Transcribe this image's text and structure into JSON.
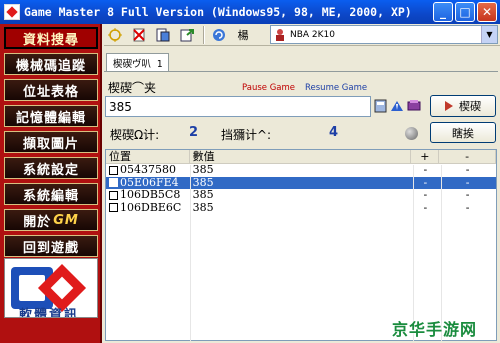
{
  "window": {
    "title": "Game Master 8 Full Version (Windows95, 98, ME, 2000, XP)",
    "buttons": {
      "minimize": "_",
      "maximize": "□",
      "close": "✕"
    }
  },
  "sidebar": {
    "items": [
      {
        "label": "資料搜尋"
      },
      {
        "label": "機械碼追蹤"
      },
      {
        "label": "位址表格"
      },
      {
        "label": "記憶體編輯"
      },
      {
        "label": "擷取圖片"
      },
      {
        "label": "系統設定"
      },
      {
        "label": "系統編輯"
      },
      {
        "label": "開於",
        "badge": "GM"
      },
      {
        "label": "回到遊戲"
      }
    ],
    "logo_label": "軟體資訊"
  },
  "toolbar": {
    "text_label": "楊",
    "game_selected": "NBA 2K10"
  },
  "tab": {
    "label": "楔碶ヴ叭 1"
  },
  "search": {
    "value_label": "楔碶⌒夹",
    "pause_hint": "Pause Game",
    "resume_hint": "Resume Game",
    "value": "385",
    "search_button": "楔碶"
  },
  "counts": {
    "found_label": "楔碶Ω计:",
    "found_value": "2",
    "scan_label": "挡獼计^:",
    "scan_value": "4",
    "action_button": "瞎挨"
  },
  "table": {
    "headers": [
      "位置",
      "數值",
      "+",
      "-"
    ],
    "rows": [
      {
        "address": "05437580",
        "value": "385",
        "plus": "-",
        "minus": "-",
        "selected": false
      },
      {
        "address": "05E06FE4",
        "value": "385",
        "plus": "-",
        "minus": "-",
        "selected": true
      },
      {
        "address": "106DB5C8",
        "value": "385",
        "plus": "-",
        "minus": "-",
        "selected": false
      },
      {
        "address": "106DBE6C",
        "value": "385",
        "plus": "-",
        "minus": "-",
        "selected": false
      }
    ]
  },
  "watermark": "京华手游网",
  "colors": {
    "sidebar": "#B01010",
    "selection": "#316AC5",
    "titlebar": "#0C47C8",
    "hint_red": "#C00000",
    "hint_blue": "#1D3FA6"
  }
}
